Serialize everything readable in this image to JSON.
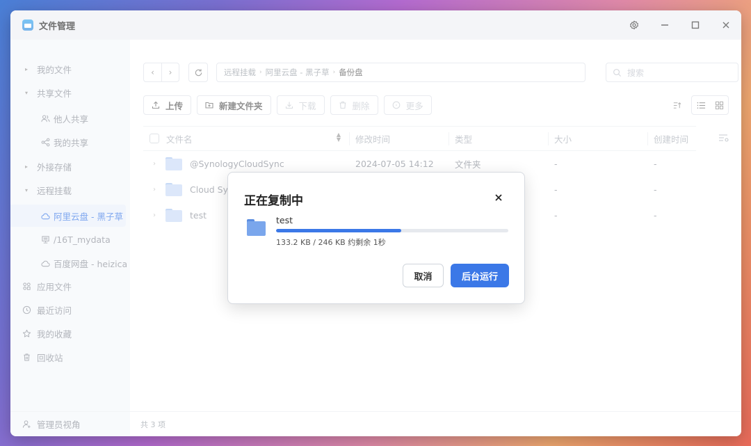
{
  "window": {
    "title": "文件管理"
  },
  "sidebar": {
    "items": [
      {
        "label": "我的文件",
        "icon": "caret-right-icon"
      },
      {
        "label": "共享文件",
        "icon": "caret-down-icon"
      },
      {
        "label": "他人共享",
        "icon": "users-icon"
      },
      {
        "label": "我的共享",
        "icon": "share-icon"
      },
      {
        "label": "外接存储",
        "icon": "caret-right-icon"
      },
      {
        "label": "远程挂载",
        "icon": "caret-down-icon"
      },
      {
        "label": "阿里云盘 - 黑子草",
        "icon": "cloud-icon",
        "active": true
      },
      {
        "label": "/16T_mydata",
        "icon": "server-icon"
      },
      {
        "label": "百度网盘 - heizica",
        "icon": "cloud-icon"
      },
      {
        "label": "应用文件",
        "icon": "apps-icon"
      },
      {
        "label": "最近访问",
        "icon": "clock-icon"
      },
      {
        "label": "我的收藏",
        "icon": "star-icon"
      },
      {
        "label": "回收站",
        "icon": "trash-icon"
      }
    ],
    "footer": "管理员视角"
  },
  "breadcrumb": [
    "远程挂载",
    "阿里云盘 - 黑子草",
    "备份盘"
  ],
  "search": {
    "placeholder": "搜索"
  },
  "toolbar": {
    "upload": "上传",
    "new_folder": "新建文件夹",
    "download": "下载",
    "delete": "删除",
    "more": "更多"
  },
  "table": {
    "headers": {
      "name": "文件名",
      "modified": "修改时间",
      "type": "类型",
      "size": "大小",
      "created": "创建时间"
    },
    "rows": [
      {
        "name": "@SynologyCloudSync",
        "modified": "2024-07-05 14:12",
        "type": "文件夹",
        "size": "-",
        "created": "-"
      },
      {
        "name": "Cloud Sync",
        "modified": "",
        "type": "",
        "size": "-",
        "created": "-"
      },
      {
        "name": "test",
        "modified": "",
        "type": "",
        "size": "-",
        "created": "-"
      }
    ]
  },
  "status": {
    "count": "共 3 项"
  },
  "dialog": {
    "title": "正在复制中",
    "file_name": "test",
    "progress_fraction": 0.54,
    "status_text": "133.2 KB / 246 KB 约剩余 1秒",
    "cancel_label": "取消",
    "background_label": "后台运行"
  },
  "colors": {
    "accent": "#3b78e7",
    "sidebar_bg": "#f5f7fb",
    "titlebar_bg": "#eef0f5"
  }
}
